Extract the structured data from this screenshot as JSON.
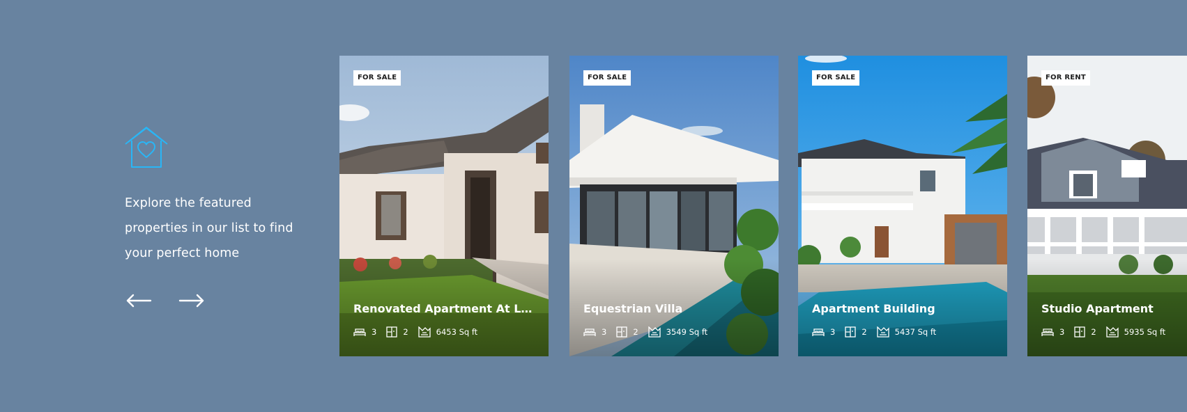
{
  "intro": {
    "icon": "house-heart-icon",
    "text": "Explore the featured properties in our list to find your perfect home",
    "prev_icon": "arrow-left-icon",
    "next_icon": "arrow-right-icon"
  },
  "colors": {
    "background": "#6883a0",
    "accent": "#29b6f6",
    "badge_bg": "#ffffff"
  },
  "cards": [
    {
      "badge": "FOR SALE",
      "title": "Renovated Apartment At Last ...",
      "beds": "3",
      "baths": "2",
      "area": "6453 Sq ft"
    },
    {
      "badge": "FOR SALE",
      "title": "Equestrian Villa",
      "beds": "3",
      "baths": "2",
      "area": "3549 Sq ft"
    },
    {
      "badge": "FOR SALE",
      "title": "Apartment Building",
      "beds": "3",
      "baths": "2",
      "area": "5437 Sq ft"
    },
    {
      "badge": "FOR RENT",
      "title": "Studio Apartment",
      "beds": "3",
      "baths": "2",
      "area": "5935 Sq ft"
    }
  ],
  "spec_icons": [
    "bed-icon",
    "bath-icon",
    "area-icon"
  ]
}
